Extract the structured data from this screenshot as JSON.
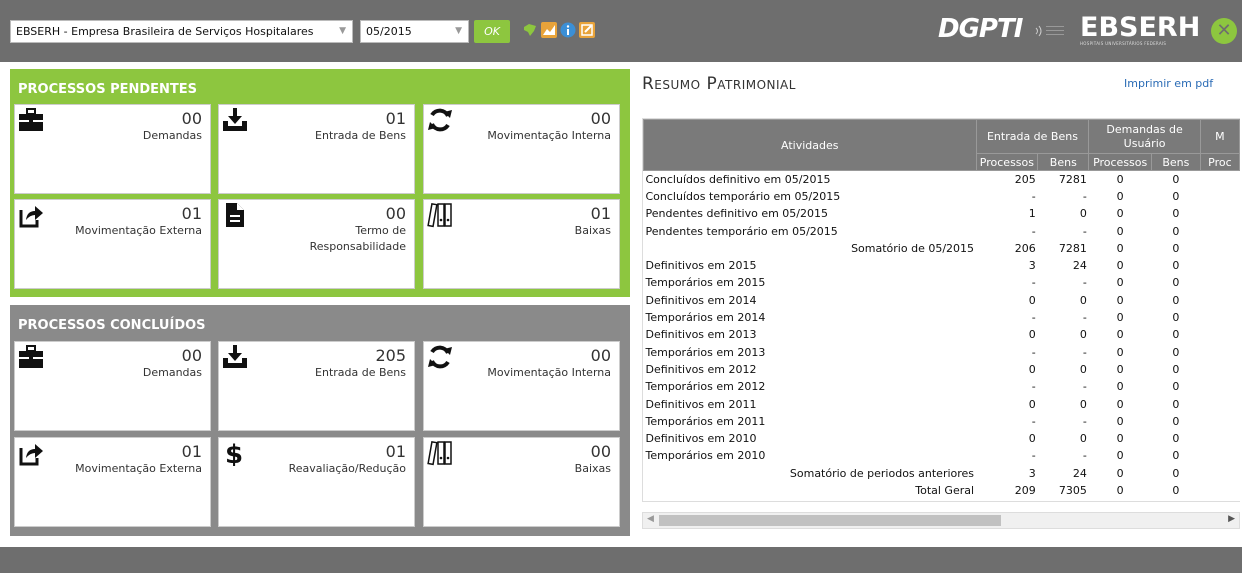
{
  "topbar": {
    "company_select": "EBSERH - Empresa Brasileira de Serviços Hospitalares",
    "period_select": "05/2015",
    "ok_label": "OK",
    "logo_dgpti": "DGPTI",
    "logo_ebserh": "EBSERH",
    "logo_ebserh_sub": "HOSPITAIS UNIVERSITÁRIOS FEDERAIS",
    "close_label": "✕"
  },
  "pendentes": {
    "title": "PROCESSOS PENDENTES",
    "tiles": [
      {
        "num": "00",
        "label": "Demandas",
        "icon": "briefcase-icon"
      },
      {
        "num": "01",
        "label": "Entrada de Bens",
        "icon": "inbox-download-icon"
      },
      {
        "num": "00",
        "label": "Movimentação Interna",
        "icon": "refresh-icon"
      },
      {
        "num": "01",
        "label": "Movimentação Externa",
        "icon": "share-icon"
      },
      {
        "num": "00",
        "label": "Termo de Responsabilidade",
        "icon": "document-icon"
      },
      {
        "num": "01",
        "label": "Baixas",
        "icon": "binders-icon"
      }
    ]
  },
  "concluidos": {
    "title": "PROCESSOS CONCLUÍDOS",
    "tiles": [
      {
        "num": "00",
        "label": "Demandas",
        "icon": "briefcase-icon"
      },
      {
        "num": "205",
        "label": "Entrada de Bens",
        "icon": "inbox-download-icon"
      },
      {
        "num": "00",
        "label": "Movimentação Interna",
        "icon": "refresh-icon"
      },
      {
        "num": "01",
        "label": "Movimentação Externa",
        "icon": "share-icon"
      },
      {
        "num": "01",
        "label": "Reavaliação/Redução",
        "icon": "dollar-icon"
      },
      {
        "num": "00",
        "label": "Baixas",
        "icon": "binders-icon"
      }
    ]
  },
  "resumo": {
    "title": "Resumo Patrimonial",
    "pdf_link": "Imprimir em pdf",
    "headers": {
      "atividades": "Atividades",
      "entrada": "Entrada de Bens",
      "demandas": "Demandas de Usuário",
      "next": "M",
      "processos": "Processos",
      "bens": "Bens",
      "proc_trunc": "Proc"
    },
    "rows": [
      {
        "label": "Concluídos definitivo em 05/2015",
        "align": "left",
        "v": [
          "205",
          "7281",
          "0",
          "0"
        ]
      },
      {
        "label": "Concluídos temporário em 05/2015",
        "align": "left",
        "v": [
          "-",
          "-",
          "0",
          "0"
        ]
      },
      {
        "label": "Pendentes definitivo em 05/2015",
        "align": "left",
        "v": [
          "1",
          "0",
          "0",
          "0"
        ]
      },
      {
        "label": "Pendentes temporário em 05/2015",
        "align": "left",
        "v": [
          "-",
          "-",
          "0",
          "0"
        ]
      },
      {
        "label": "Somatório de 05/2015",
        "align": "right",
        "v": [
          "206",
          "7281",
          "0",
          "0"
        ]
      },
      {
        "label": "Definitivos em 2015",
        "align": "left",
        "v": [
          "3",
          "24",
          "0",
          "0"
        ]
      },
      {
        "label": "Temporários em 2015",
        "align": "left",
        "v": [
          "-",
          "-",
          "0",
          "0"
        ]
      },
      {
        "label": "Definitivos em 2014",
        "align": "left",
        "v": [
          "0",
          "0",
          "0",
          "0"
        ]
      },
      {
        "label": "Temporários em 2014",
        "align": "left",
        "v": [
          "-",
          "-",
          "0",
          "0"
        ]
      },
      {
        "label": "Definitivos em 2013",
        "align": "left",
        "v": [
          "0",
          "0",
          "0",
          "0"
        ]
      },
      {
        "label": "Temporários em 2013",
        "align": "left",
        "v": [
          "-",
          "-",
          "0",
          "0"
        ]
      },
      {
        "label": "Definitivos em 2012",
        "align": "left",
        "v": [
          "0",
          "0",
          "0",
          "0"
        ]
      },
      {
        "label": "Temporários em 2012",
        "align": "left",
        "v": [
          "-",
          "-",
          "0",
          "0"
        ]
      },
      {
        "label": "Definitivos em 2011",
        "align": "left",
        "v": [
          "0",
          "0",
          "0",
          "0"
        ]
      },
      {
        "label": "Temporários em 2011",
        "align": "left",
        "v": [
          "-",
          "-",
          "0",
          "0"
        ]
      },
      {
        "label": "Definitivos em 2010",
        "align": "left",
        "v": [
          "0",
          "0",
          "0",
          "0"
        ]
      },
      {
        "label": "Temporários em 2010",
        "align": "left",
        "v": [
          "-",
          "-",
          "0",
          "0"
        ]
      },
      {
        "label": "Somatório de periodos anteriores",
        "align": "right",
        "v": [
          "3",
          "24",
          "0",
          "0"
        ]
      },
      {
        "label": "Total Geral",
        "align": "right",
        "v": [
          "209",
          "7305",
          "0",
          "0"
        ]
      }
    ]
  },
  "colors": {
    "green": "#8dc63f",
    "gray_bar": "#6e6e6e",
    "panel_gray": "#8a8a8a",
    "link_blue": "#2a6bb5"
  }
}
